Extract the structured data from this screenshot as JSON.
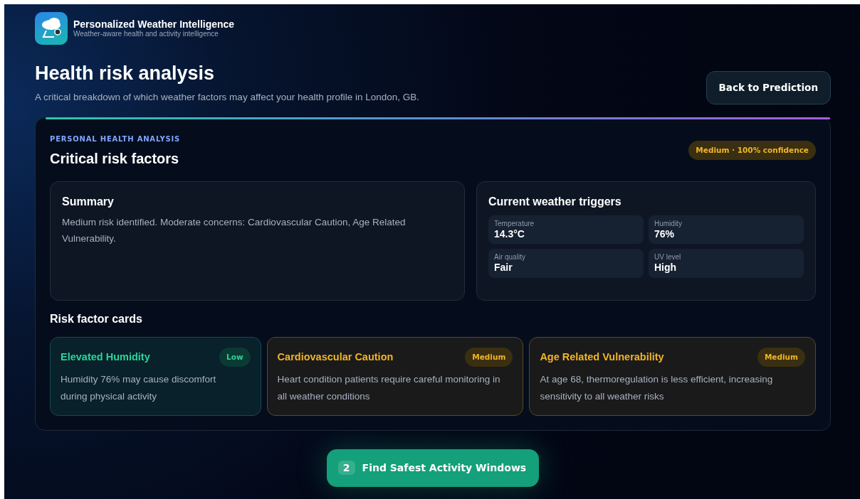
{
  "header": {
    "app_title": "Personalized Weather Intelligence",
    "app_subtitle": "Weather-aware health and activity intelligence"
  },
  "page": {
    "title": "Health risk analysis",
    "subtitle": "A critical breakdown of which weather factors may affect your health profile in London, GB.",
    "back_button": "Back to Prediction"
  },
  "analysis": {
    "eyebrow": "PERSONAL HEALTH ANALYSIS",
    "title": "Critical risk factors",
    "risk_badge": "Medium · 100% confidence",
    "kind": "medium",
    "summary": {
      "title": "Summary",
      "text": "Medium risk identified. Moderate concerns: Cardiovascular Caution, Age Related Vulnerability."
    },
    "triggers": {
      "title": "Current weather triggers",
      "items": [
        {
          "label": "Temperature",
          "value": "14.3°C"
        },
        {
          "label": "Humidity",
          "value": "76%"
        },
        {
          "label": "Air quality",
          "value": "Fair"
        },
        {
          "label": "UV level",
          "value": "High"
        }
      ]
    },
    "cards_title": "Risk factor cards",
    "cards": [
      {
        "title": "Elevated Humidity",
        "kind": "low",
        "badge": "Low",
        "text": "Humidity 76% may cause discomfort during physical activity"
      },
      {
        "title": "Cardiovascular Caution",
        "kind": "medium",
        "badge": "Medium",
        "text": "Heart condition patients require careful monitoring in all weather conditions"
      },
      {
        "title": "Age Related Vulnerability",
        "kind": "medium",
        "badge": "Medium",
        "text": "At age 68, thermoregulation is less efficient, increasing sensitivity to all weather risks"
      }
    ]
  },
  "next_step": {
    "number": "2",
    "label": "Find Safest Activity Windows"
  }
}
